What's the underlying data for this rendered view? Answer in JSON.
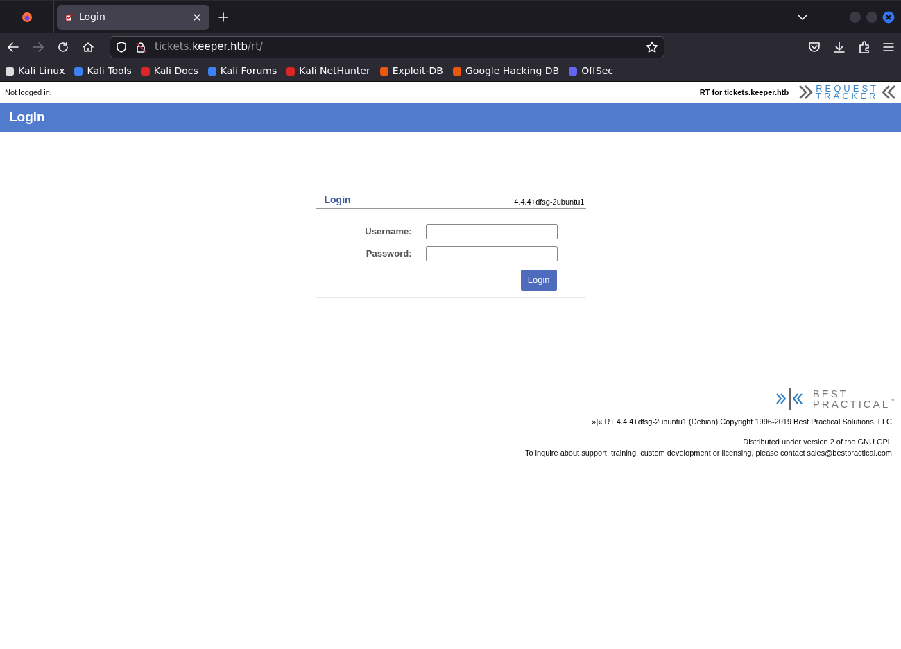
{
  "browser": {
    "tabs": [
      {
        "title": "Login",
        "selected": true
      }
    ],
    "url": {
      "host_prefix": "tickets.",
      "host_main": "keeper.htb",
      "path": "/rt/"
    },
    "bookmarks": [
      {
        "label": "Kali Linux",
        "color": "#dddddd"
      },
      {
        "label": "Kali Tools",
        "color": "#3b82f6"
      },
      {
        "label": "Kali Docs",
        "color": "#dc2626"
      },
      {
        "label": "Kali Forums",
        "color": "#3b82f6"
      },
      {
        "label": "Kali NetHunter",
        "color": "#dc2626"
      },
      {
        "label": "Exploit-DB",
        "color": "#ea580c"
      },
      {
        "label": "Google Hacking DB",
        "color": "#ea580c"
      },
      {
        "label": "OffSec",
        "color": "#6366f1"
      }
    ]
  },
  "page": {
    "status": "Not logged in.",
    "site": "RT for tickets.keeper.htb",
    "logo": {
      "line1": "REQUEST",
      "line2": "TRACKER"
    },
    "title": "Login",
    "login_box": {
      "title": "Login",
      "version": "4.4.4+dfsg-2ubuntu1",
      "fields": [
        {
          "label": "Username:"
        },
        {
          "label": "Password:"
        }
      ],
      "button": "Login"
    },
    "footer": {
      "logo": {
        "line1": "BEST",
        "line2": "PRACTICAL",
        "mark": "™"
      },
      "copyright": "»|« RT 4.4.4+dfsg-2ubuntu1 (Debian) Copyright 1996-2019 Best Practical Solutions, LLC.",
      "license": "Distributed under version 2 of the GNU GPL.",
      "contact": "To inquire about support, training, custom development or licensing, please contact sales@bestpractical.com."
    }
  }
}
